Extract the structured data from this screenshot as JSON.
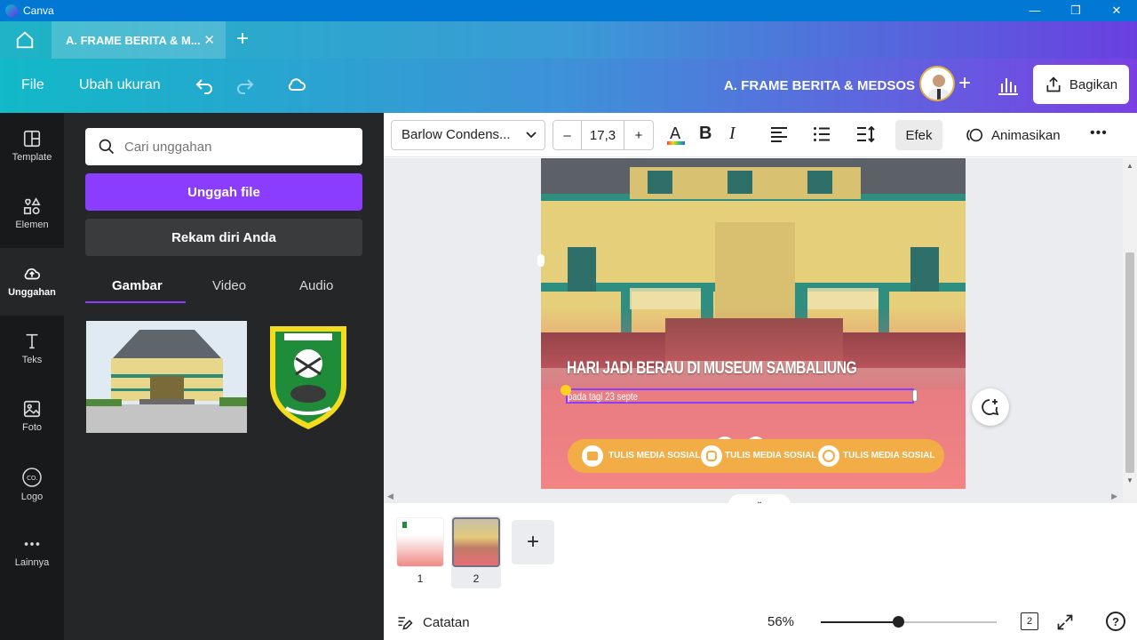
{
  "window": {
    "title": "Canva",
    "minimize": "—",
    "maximize": "❐",
    "close": "✕"
  },
  "tabs": {
    "doc_tab": "A. FRAME BERITA & M...",
    "close": "✕",
    "new": "+"
  },
  "toolbar": {
    "file": "File",
    "resize": "Ubah ukuran",
    "doc_title": "A. FRAME BERITA & MEDSOS",
    "share": "Bagikan"
  },
  "rail": [
    {
      "label": "Template",
      "icon": "template-icon"
    },
    {
      "label": "Elemen",
      "icon": "elements-icon"
    },
    {
      "label": "Unggahan",
      "icon": "upload-icon"
    },
    {
      "label": "Teks",
      "icon": "text-icon"
    },
    {
      "label": "Foto",
      "icon": "photo-icon"
    },
    {
      "label": "Logo",
      "icon": "logo-icon"
    },
    {
      "label": "Lainnya",
      "icon": "more-icon"
    }
  ],
  "panel": {
    "search_placeholder": "Cari unggahan",
    "upload_button": "Unggah file",
    "record_button": "Rekam diri Anda",
    "tabs": [
      "Gambar",
      "Video",
      "Audio"
    ]
  },
  "editor_toolbar": {
    "font": "Barlow Condens...",
    "minus": "–",
    "size": "17,3",
    "plus": "+",
    "bold": "B",
    "italic": "I",
    "effects": "Efek",
    "animate": "Animasikan",
    "more": "•••"
  },
  "design": {
    "headline": "HARI JADI BERAU DI MUSEUM SAMBALIUNG",
    "subtext": "pada tagl 23 septe",
    "social": [
      "TULIS MEDIA SOSIAL",
      "TULIS MEDIA SOSIAL",
      "TULIS MEDIA SOSIAL"
    ]
  },
  "pages": {
    "items": [
      "1",
      "2"
    ],
    "add": "+"
  },
  "bottom": {
    "notes": "Catatan",
    "zoom": "56%",
    "page_count": "2",
    "help": "?"
  },
  "colors": {
    "accent": "#8b3dff",
    "rail_bg": "#18191b",
    "panel_bg": "#252627",
    "titlebar": "#0078d4"
  }
}
